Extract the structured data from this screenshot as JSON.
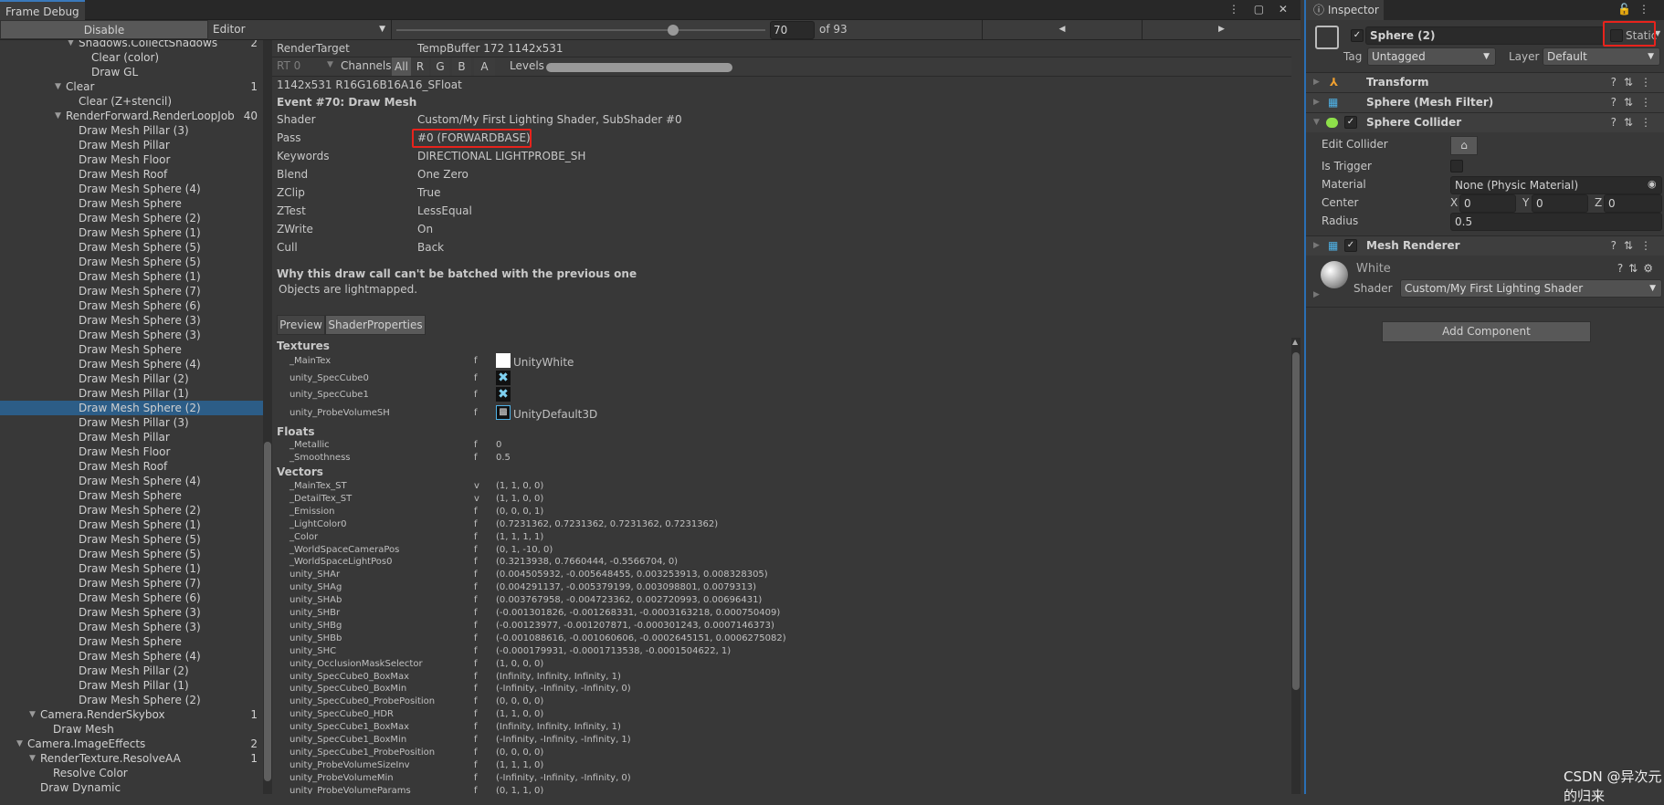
{
  "window": {
    "tab_label": "Frame Debug",
    "menu_icons": "⋮ ▢ ✕"
  },
  "toolbar": {
    "disable_label": "Disable",
    "target_dropdown": "Editor",
    "event_index": "70",
    "event_total": "of 93",
    "event_progress": 0.75,
    "prev_icon": "◀",
    "next_icon": "▶"
  },
  "tree": [
    {
      "label": "Shadows.CollectShadows",
      "count": "2",
      "level": 5,
      "expanded": true
    },
    {
      "label": "Clear (color)",
      "level": 6
    },
    {
      "label": "Draw GL",
      "level": 6
    },
    {
      "label": "Clear",
      "count": "1",
      "level": 4,
      "expanded": true
    },
    {
      "label": "Clear (Z+stencil)",
      "level": 5
    },
    {
      "label": "RenderForward.RenderLoopJob",
      "count": "40",
      "level": 4,
      "expanded": true
    },
    {
      "label": "Draw Mesh Pillar (3)",
      "level": 5
    },
    {
      "label": "Draw Mesh Pillar",
      "level": 5
    },
    {
      "label": "Draw Mesh Floor",
      "level": 5
    },
    {
      "label": "Draw Mesh Roof",
      "level": 5
    },
    {
      "label": "Draw Mesh Sphere (4)",
      "level": 5
    },
    {
      "label": "Draw Mesh Sphere",
      "level": 5
    },
    {
      "label": "Draw Mesh Sphere (2)",
      "level": 5
    },
    {
      "label": "Draw Mesh Sphere (1)",
      "level": 5
    },
    {
      "label": "Draw Mesh Sphere (5)",
      "level": 5
    },
    {
      "label": "Draw Mesh Sphere (5)",
      "level": 5
    },
    {
      "label": "Draw Mesh Sphere (1)",
      "level": 5
    },
    {
      "label": "Draw Mesh Sphere (7)",
      "level": 5
    },
    {
      "label": "Draw Mesh Sphere (6)",
      "level": 5
    },
    {
      "label": "Draw Mesh Sphere (3)",
      "level": 5
    },
    {
      "label": "Draw Mesh Sphere (3)",
      "level": 5
    },
    {
      "label": "Draw Mesh Sphere",
      "level": 5
    },
    {
      "label": "Draw Mesh Sphere (4)",
      "level": 5
    },
    {
      "label": "Draw Mesh Pillar (2)",
      "level": 5
    },
    {
      "label": "Draw Mesh Pillar (1)",
      "level": 5
    },
    {
      "label": "Draw Mesh Sphere (2)",
      "level": 5,
      "selected": true
    },
    {
      "label": "Draw Mesh Pillar (3)",
      "level": 5
    },
    {
      "label": "Draw Mesh Pillar",
      "level": 5
    },
    {
      "label": "Draw Mesh Floor",
      "level": 5
    },
    {
      "label": "Draw Mesh Roof",
      "level": 5
    },
    {
      "label": "Draw Mesh Sphere (4)",
      "level": 5
    },
    {
      "label": "Draw Mesh Sphere",
      "level": 5
    },
    {
      "label": "Draw Mesh Sphere (2)",
      "level": 5
    },
    {
      "label": "Draw Mesh Sphere (1)",
      "level": 5
    },
    {
      "label": "Draw Mesh Sphere (5)",
      "level": 5
    },
    {
      "label": "Draw Mesh Sphere (5)",
      "level": 5
    },
    {
      "label": "Draw Mesh Sphere (1)",
      "level": 5
    },
    {
      "label": "Draw Mesh Sphere (7)",
      "level": 5
    },
    {
      "label": "Draw Mesh Sphere (6)",
      "level": 5
    },
    {
      "label": "Draw Mesh Sphere (3)",
      "level": 5
    },
    {
      "label": "Draw Mesh Sphere (3)",
      "level": 5
    },
    {
      "label": "Draw Mesh Sphere",
      "level": 5
    },
    {
      "label": "Draw Mesh Sphere (4)",
      "level": 5
    },
    {
      "label": "Draw Mesh Pillar (2)",
      "level": 5
    },
    {
      "label": "Draw Mesh Pillar (1)",
      "level": 5
    },
    {
      "label": "Draw Mesh Sphere (2)",
      "level": 5
    },
    {
      "label": "Camera.RenderSkybox",
      "count": "1",
      "level": 2,
      "expanded": true
    },
    {
      "label": "Draw Mesh",
      "level": 3
    },
    {
      "label": "Camera.ImageEffects",
      "count": "2",
      "level": 1,
      "expanded": true
    },
    {
      "label": "RenderTexture.ResolveAA",
      "count": "1",
      "level": 2,
      "expanded": true
    },
    {
      "label": "Resolve Color",
      "level": 3
    },
    {
      "label": "Draw Dynamic",
      "level": 2
    }
  ],
  "details": {
    "render_target_label": "RenderTarget",
    "render_target_value": "TempBuffer 172 1142x531",
    "rt_dropdown": "RT 0",
    "channels_label": "Channels",
    "channels": [
      "All",
      "R",
      "G",
      "B",
      "A"
    ],
    "channels_selected": "All",
    "levels_label": "Levels",
    "format": "1142x531 R16G16B16A16_SFloat",
    "event_title": "Event #70: Draw Mesh",
    "rows": [
      {
        "label": "Shader",
        "value": "Custom/My First Lighting Shader, SubShader #0"
      },
      {
        "label": "Pass",
        "value": "#0 (FORWARDBASE)",
        "highlighted": true
      },
      {
        "label": "Keywords",
        "value": "DIRECTIONAL LIGHTPROBE_SH"
      },
      {
        "label": "Blend",
        "value": "One Zero"
      },
      {
        "label": "ZClip",
        "value": "True"
      },
      {
        "label": "ZTest",
        "value": "LessEqual"
      },
      {
        "label": "ZWrite",
        "value": "On"
      },
      {
        "label": "Cull",
        "value": "Back"
      }
    ],
    "batch_title": "Why this draw call can't be batched with the previous one",
    "batch_reason": "Objects are lightmapped.",
    "tabs": [
      "Preview",
      "ShaderProperties"
    ],
    "active_tab": "ShaderProperties",
    "textures_header": "Textures",
    "textures": [
      {
        "name": "_MainTex",
        "type": "f",
        "value": "UnityWhite",
        "icon": "white-texture-icon"
      },
      {
        "name": "unity_SpecCube0",
        "type": "f",
        "value": "",
        "icon": "missing-cubemap-icon"
      },
      {
        "name": "unity_SpecCube1",
        "type": "f",
        "value": "",
        "icon": "missing-cubemap-icon"
      },
      {
        "name": "unity_ProbeVolumeSH",
        "type": "f",
        "value": "UnityDefault3D",
        "icon": "texture3d-icon"
      }
    ],
    "floats_header": "Floats",
    "floats": [
      {
        "name": "_Metallic",
        "type": "f",
        "value": "0"
      },
      {
        "name": "_Smoothness",
        "type": "f",
        "value": "0.5"
      }
    ],
    "vectors_header": "Vectors",
    "vectors": [
      {
        "name": "_MainTex_ST",
        "type": "v",
        "value": "(1, 1, 0, 0)"
      },
      {
        "name": "_DetailTex_ST",
        "type": "v",
        "value": "(1, 1, 0, 0)"
      },
      {
        "name": "_Emission",
        "type": "f",
        "value": "(0, 0, 0, 1)"
      },
      {
        "name": "_LightColor0",
        "type": "f",
        "value": "(0.7231362, 0.7231362, 0.7231362, 0.7231362)"
      },
      {
        "name": "_Color",
        "type": "f",
        "value": "(1, 1, 1, 1)"
      },
      {
        "name": "_WorldSpaceCameraPos",
        "type": "f",
        "value": "(0, 1, -10, 0)"
      },
      {
        "name": "_WorldSpaceLightPos0",
        "type": "f",
        "value": "(0.3213938, 0.7660444, -0.5566704, 0)"
      },
      {
        "name": "unity_SHAr",
        "type": "f",
        "value": "(0.004505932, -0.005648455, 0.003253913, 0.008328305)"
      },
      {
        "name": "unity_SHAg",
        "type": "f",
        "value": "(0.004291137, -0.005379199, 0.003098801, 0.0079313)"
      },
      {
        "name": "unity_SHAb",
        "type": "f",
        "value": "(0.003767958, -0.004723362, 0.002720993, 0.00696431)"
      },
      {
        "name": "unity_SHBr",
        "type": "f",
        "value": "(-0.001301826, -0.001268331, -0.0003163218, 0.000750409)"
      },
      {
        "name": "unity_SHBg",
        "type": "f",
        "value": "(-0.00123977, -0.001207871, -0.000301243, 0.0007146373)"
      },
      {
        "name": "unity_SHBb",
        "type": "f",
        "value": "(-0.001088616, -0.001060606, -0.0002645151, 0.0006275082)"
      },
      {
        "name": "unity_SHC",
        "type": "f",
        "value": "(-0.000179931, -0.0001713538, -0.0001504622, 1)"
      },
      {
        "name": "unity_OcclusionMaskSelector",
        "type": "f",
        "value": "(1, 0, 0, 0)"
      },
      {
        "name": "unity_SpecCube0_BoxMax",
        "type": "f",
        "value": "(Infinity, Infinity, Infinity, 1)"
      },
      {
        "name": "unity_SpecCube0_BoxMin",
        "type": "f",
        "value": "(-Infinity, -Infinity, -Infinity, 0)"
      },
      {
        "name": "unity_SpecCube0_ProbePosition",
        "type": "f",
        "value": "(0, 0, 0, 0)"
      },
      {
        "name": "unity_SpecCube0_HDR",
        "type": "f",
        "value": "(1, 1, 0, 0)"
      },
      {
        "name": "unity_SpecCube1_BoxMax",
        "type": "f",
        "value": "(Infinity, Infinity, Infinity, 1)"
      },
      {
        "name": "unity_SpecCube1_BoxMin",
        "type": "f",
        "value": "(-Infinity, -Infinity, -Infinity, 1)"
      },
      {
        "name": "unity_SpecCube1_ProbePosition",
        "type": "f",
        "value": "(0, 0, 0, 0)"
      },
      {
        "name": "unity_ProbeVolumeSizeInv",
        "type": "f",
        "value": "(1, 1, 1, 0)"
      },
      {
        "name": "unity_ProbeVolumeMin",
        "type": "f",
        "value": "(-Infinity, -Infinity, -Infinity, 0)"
      },
      {
        "name": "unity_ProbeVolumeParams",
        "type": "f",
        "value": "(0, 1, 1, 0)"
      }
    ]
  },
  "inspector": {
    "tab_label": "Inspector",
    "object_name": "Sphere (2)",
    "static_label": "Static",
    "tag_label": "Tag",
    "tag_value": "Untagged",
    "layer_label": "Layer",
    "layer_value": "Default",
    "components": {
      "transform": "Transform",
      "mesh_filter": "Sphere (Mesh Filter)",
      "sphere_collider": "Sphere Collider",
      "mesh_renderer": "Mesh Renderer"
    },
    "collider": {
      "edit_collider_label": "Edit Collider",
      "is_trigger_label": "Is Trigger",
      "material_label": "Material",
      "material_value": "None (Physic Material)",
      "center_label": "Center",
      "x_label": "X",
      "x": "0",
      "y_label": "Y",
      "y": "0",
      "z_label": "Z",
      "z": "0",
      "radius_label": "Radius",
      "radius": "0.5"
    },
    "material": {
      "name": "White",
      "shader_label": "Shader",
      "shader_value": "Custom/My First Lighting Shader"
    },
    "add_component_label": "Add Component"
  },
  "watermark": "CSDN @异次元的归来",
  "colors": {
    "selection": "#2c5d87",
    "highlight_box": "#e8231c",
    "accent": "#3a79bb"
  }
}
